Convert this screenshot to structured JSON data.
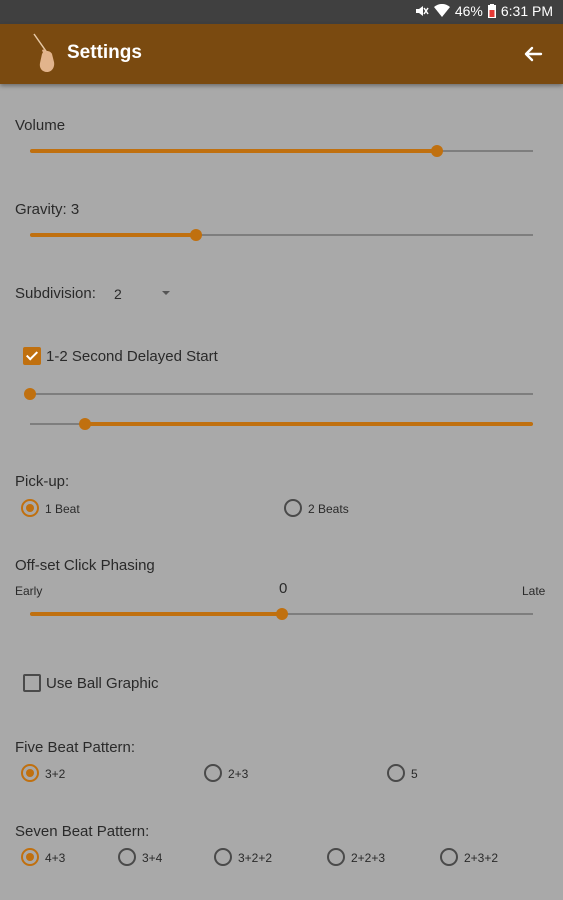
{
  "status": {
    "battery": "46%",
    "time": "6:31 PM"
  },
  "appbar": {
    "title": "Settings"
  },
  "volume": {
    "label": "Volume",
    "value_fraction": 0.81
  },
  "gravity": {
    "label": "Gravity: 3",
    "value_fraction": 0.33
  },
  "subdivision": {
    "label": "Subdivision:",
    "selected": "2"
  },
  "delayed_start": {
    "label": "1-2 Second Delayed Start",
    "checked": true,
    "range_low_fraction": 0.0,
    "range_high_fraction": 0.11
  },
  "pickup": {
    "label": "Pick-up:",
    "options": [
      "1 Beat",
      "2 Beats"
    ],
    "selected_index": 0
  },
  "offset": {
    "label": "Off-set Click Phasing",
    "early_label": "Early",
    "late_label": "Late",
    "value": "0",
    "value_fraction": 0.5
  },
  "ball_graphic": {
    "label": "Use Ball Graphic",
    "checked": false
  },
  "five_beat": {
    "label": "Five Beat Pattern:",
    "options": [
      "3+2",
      "2+3",
      "5"
    ],
    "selected_index": 0
  },
  "seven_beat": {
    "label": "Seven Beat Pattern:",
    "options": [
      "4+3",
      "3+4",
      "3+2+2",
      "2+2+3",
      "2+3+2"
    ],
    "selected_index": 0
  },
  "colors": {
    "accent": "#c0700f",
    "appbar": "#7a4a10",
    "background": "#a9a9a9"
  }
}
